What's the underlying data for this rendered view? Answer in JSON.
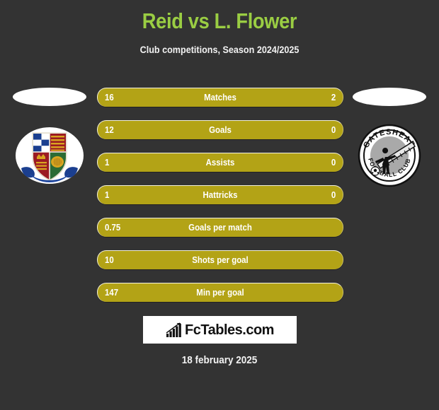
{
  "header": {
    "title": "Reid vs L. Flower",
    "subtitle": "Club competitions, Season 2024/2025",
    "title_color": "#9ACD43"
  },
  "theme": {
    "background": "#333333",
    "bar_color": "#B3A316",
    "text_color": "#FFFFFF"
  },
  "home": {
    "crest_name": "home-club-crest",
    "crest_description": "quartered heraldic shield with blue chequers, gold lions, crown and ribbon"
  },
  "away": {
    "crest_name": "gateshead-fc-crest",
    "crest_top_text": "GATESHEAD",
    "crest_bottom_text": "FOOTBALL CLUB"
  },
  "stats": {
    "rows": [
      {
        "label": "Matches",
        "left": "16",
        "right": "2"
      },
      {
        "label": "Goals",
        "left": "12",
        "right": "0"
      },
      {
        "label": "Assists",
        "left": "1",
        "right": "0"
      },
      {
        "label": "Hattricks",
        "left": "1",
        "right": "0"
      },
      {
        "label": "Goals per match",
        "left": "0.75",
        "right": ""
      },
      {
        "label": "Shots per goal",
        "left": "10",
        "right": ""
      },
      {
        "label": "Min per goal",
        "left": "147",
        "right": ""
      }
    ]
  },
  "footer": {
    "logo_text": "FcTables.com",
    "logo_icon": "bar-chart-icon",
    "date": "18 february 2025"
  }
}
